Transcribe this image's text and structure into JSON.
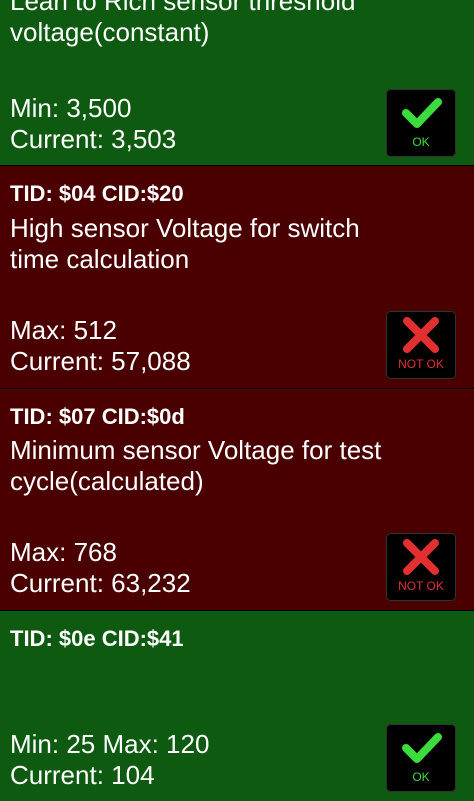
{
  "tests": [
    {
      "status": "ok",
      "tid": "",
      "description": "Lean to Rich sensor threshold voltage(constant)",
      "limits": "Min: 3,500",
      "current": "Current: 3,503",
      "badge": "OK"
    },
    {
      "status": "fail",
      "tid": "TID: $04 CID:$20",
      "description": "High sensor Voltage for switch time calculation",
      "limits": "Max: 512",
      "current": "Current: 57,088",
      "badge": "NOT OK"
    },
    {
      "status": "fail",
      "tid": "TID: $07 CID:$0d",
      "description": "Minimum sensor Voltage for test cycle(calculated)",
      "limits": "Max: 768",
      "current": "Current: 63,232",
      "badge": "NOT OK"
    },
    {
      "status": "ok",
      "tid": "TID: $0e CID:$41",
      "description": "",
      "limits": "Min: 25  Max: 120",
      "current": "Current: 104",
      "badge": "OK"
    }
  ],
  "colors": {
    "pass_background": "#0d5a10",
    "fail_background": "#4a0000",
    "ok_icon": "#3ddc3d",
    "not_ok_icon": "#e23030"
  },
  "icons": {
    "ok": "checkmark-icon",
    "not_ok": "x-mark-icon"
  }
}
